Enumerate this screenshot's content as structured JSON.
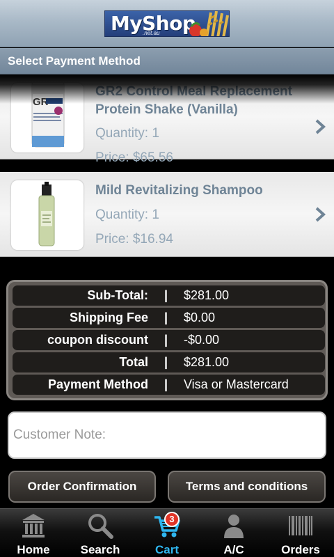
{
  "header": {
    "logo_text": "MyShop",
    "logo_sub": ".net.au"
  },
  "section_title": "Select Payment Method",
  "products": [
    {
      "name_line1": "GR2 Control Meal Replacement",
      "name_line2": "Protein Shake (Vanilla)",
      "quantity": "Quantity: 1",
      "price": "Price: $65.56",
      "thumb_label": "GR CONTROL"
    },
    {
      "name": "Mild Revitalizing Shampoo",
      "quantity": "Quantity: 1",
      "price": "Price: $16.94"
    }
  ],
  "summary": {
    "separator": "|",
    "rows": [
      {
        "label": "Sub-Total:",
        "value": "$281.00"
      },
      {
        "label": "Shipping Fee",
        "value": "$0.00"
      },
      {
        "label": "coupon discount",
        "value": "-$0.00"
      },
      {
        "label": "Total",
        "value": "$281.00"
      },
      {
        "label": "Payment Method",
        "value": "Visa or Mastercard"
      }
    ]
  },
  "note": {
    "placeholder": "Customer Note:",
    "value": ""
  },
  "buttons": {
    "order_confirmation": "Order Confirmation",
    "terms": "Terms and conditions"
  },
  "tabs": [
    {
      "label": "Home",
      "icon": "bank-icon"
    },
    {
      "label": "Search",
      "icon": "search-icon"
    },
    {
      "label": "Cart",
      "icon": "cart-icon",
      "active": true,
      "badge": "3"
    },
    {
      "label": "A/C",
      "icon": "user-icon"
    },
    {
      "label": "Orders",
      "icon": "barcode-icon"
    }
  ],
  "colors": {
    "accent": "#2fb6ef",
    "product_name": "#6f8496",
    "product_meta": "#94a7b7",
    "badge": "#e03528"
  }
}
